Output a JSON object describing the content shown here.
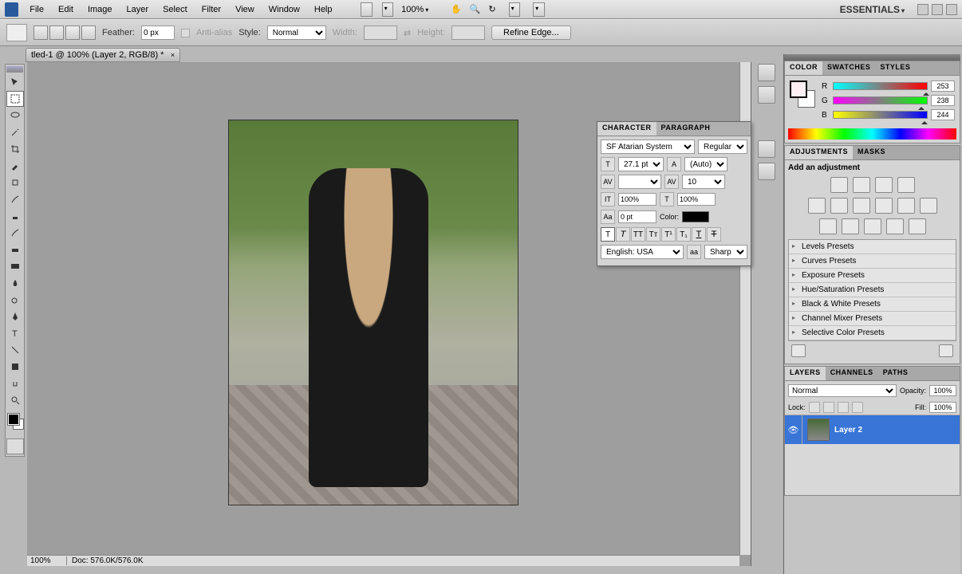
{
  "menu": {
    "file": "File",
    "edit": "Edit",
    "image": "Image",
    "layer": "Layer",
    "select": "Select",
    "filter": "Filter",
    "view": "View",
    "window": "Window",
    "help": "Help"
  },
  "menubar_zoom": "100%",
  "workspace": "ESSENTIALS",
  "options": {
    "feather_label": "Feather:",
    "feather_value": "0 px",
    "antialias_label": "Anti-alias",
    "style_label": "Style:",
    "style_value": "Normal",
    "width_label": "Width:",
    "height_label": "Height:",
    "refine": "Refine Edge..."
  },
  "doc_tab": "tled-1 @ 100% (Layer 2, RGB/8) *",
  "status": {
    "zoom": "100%",
    "doc": "Doc: 576.0K/576.0K"
  },
  "character": {
    "tab_char": "CHARACTER",
    "tab_para": "PARAGRAPH",
    "font": "SF Atarian System",
    "style": "Regular",
    "size": "27.1 pt",
    "leading": "(Auto)",
    "kerning": "",
    "tracking": "10",
    "hscale": "100%",
    "vscale": "100%",
    "baseline": "0 pt",
    "color_label": "Color:",
    "lang": "English: USA",
    "aa": "Sharp"
  },
  "color": {
    "tab_color": "COLOR",
    "tab_swatches": "SWATCHES",
    "tab_styles": "STYLES",
    "r_label": "R",
    "r_val": "253",
    "g_label": "G",
    "g_val": "238",
    "b_label": "B",
    "b_val": "244"
  },
  "adjustments": {
    "tab_adj": "ADJUSTMENTS",
    "tab_masks": "MASKS",
    "title": "Add an adjustment",
    "presets": [
      "Levels Presets",
      "Curves Presets",
      "Exposure Presets",
      "Hue/Saturation Presets",
      "Black & White Presets",
      "Channel Mixer Presets",
      "Selective Color Presets"
    ]
  },
  "layers": {
    "tab_layers": "LAYERS",
    "tab_channels": "CHANNELS",
    "tab_paths": "PATHS",
    "blend": "Normal",
    "opacity_label": "Opacity:",
    "opacity_val": "100%",
    "lock_label": "Lock:",
    "fill_label": "Fill:",
    "fill_val": "100%",
    "layer_name": "Layer 2"
  }
}
